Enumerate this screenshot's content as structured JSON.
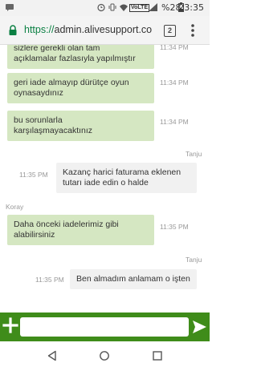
{
  "status_bar": {
    "network_label": "VoLTE",
    "battery_percent": "%28",
    "time": "23:35"
  },
  "browser": {
    "url_scheme": "https://",
    "url_host": "admin.alivesupport.co",
    "tab_count": "2"
  },
  "messages": [
    {
      "direction": "in",
      "lines": [
        "sizlere gerekli olan tam",
        "açıklamalar fazlasıyla yapılmıştır"
      ],
      "time": "11:34 PM"
    },
    {
      "direction": "in",
      "lines": [
        "geri iade almayıp dürütçe oyun",
        "oynasaydınız"
      ],
      "time": "11:34 PM"
    },
    {
      "direction": "in",
      "lines": [
        "bu sorunlarla",
        "karşılaşmayacaktınız"
      ],
      "time": "11:34 PM"
    },
    {
      "direction": "out",
      "sender": "Tanju",
      "lines": [
        "Kazanç harici faturama eklenen",
        "tutarı iade edin o halde"
      ],
      "time": "11:35 PM"
    },
    {
      "direction": "in",
      "sender": "Koray",
      "lines": [
        "Daha önceki iadelerimiz gibi",
        "alabilirsiniz"
      ],
      "time": "11:35 PM"
    },
    {
      "direction": "out",
      "sender": "Tanju",
      "lines": [
        "Ben almadım anlamam o işten"
      ],
      "time": "11:35 PM"
    }
  ],
  "composer": {
    "placeholder": "",
    "value": ""
  },
  "icons": {
    "lock": "lock-icon",
    "tabs": "tabs-icon",
    "menu": "overflow-menu-icon",
    "add": "plus-icon",
    "send": "send-icon",
    "back": "back-triangle-icon",
    "home": "home-circle-icon",
    "recents": "recents-square-icon"
  },
  "colors": {
    "incoming_bubble": "#d5e7c2",
    "outgoing_bubble": "#f1f1f1",
    "composer_bar": "#3f8c1a",
    "url_scheme": "#0b8043"
  }
}
